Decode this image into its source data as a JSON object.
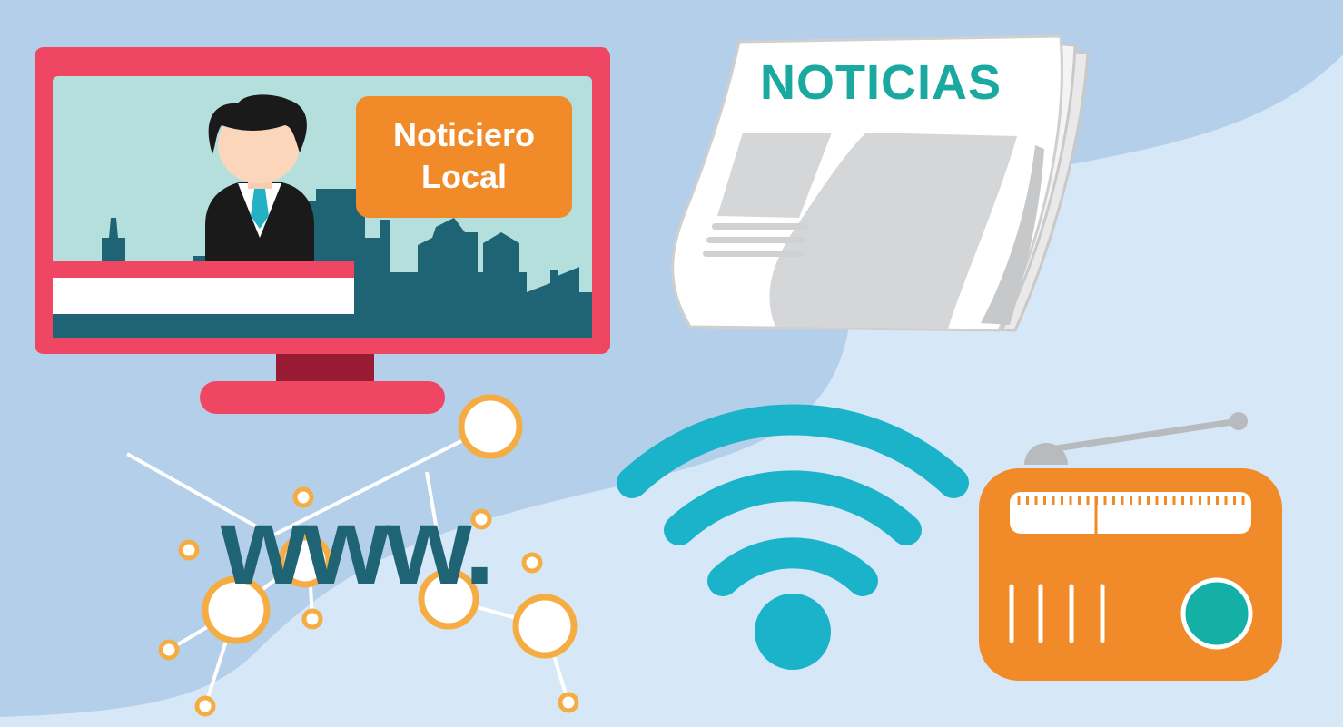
{
  "newspaper": {
    "title": "NOTICIAS"
  },
  "tv": {
    "badge_line1": "Noticiero",
    "badge_line2": "Local"
  },
  "web": {
    "text": "www."
  },
  "colors": {
    "background_dark": "#b4cfe9",
    "background_light": "#d6e8f7",
    "tv_frame": "#ee4663",
    "tv_screen": "#b4dfdd",
    "city": "#1f6474",
    "badge": "#f18a28",
    "wifi": "#1bb3c9",
    "radio": "#f18a28",
    "radio_knob": "#14b0a6",
    "node_ring": "#f5ad43"
  },
  "icons": [
    "tv-icon",
    "newspaper-icon",
    "wifi-icon",
    "radio-icon",
    "network-icon"
  ]
}
